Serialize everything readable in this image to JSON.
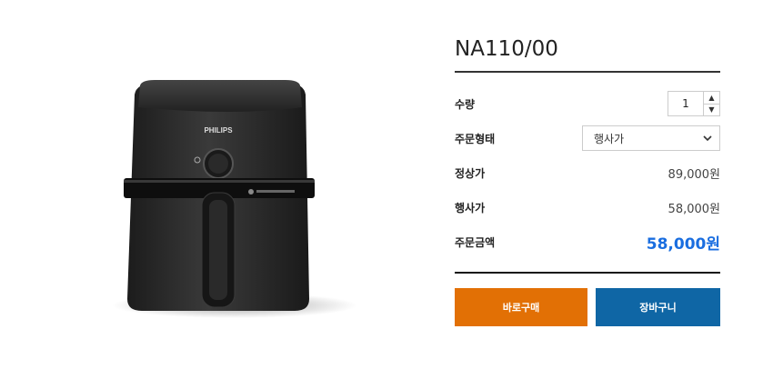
{
  "product": {
    "title": "NA110/00",
    "image_brand": "PHILIPS"
  },
  "options": {
    "quantity_label": "수량",
    "quantity_value": "1",
    "order_type_label": "주문형태",
    "order_type_selected": "행사가",
    "regular_price_label": "정상가",
    "regular_price_value": "89,000원",
    "event_price_label": "행사가",
    "event_price_value": "58,000원",
    "total_label": "주문금액",
    "total_value": "58,000원"
  },
  "actions": {
    "buy_now_label": "바로구매",
    "cart_label": "장바구니"
  },
  "colors": {
    "buy_button": "#e27005",
    "cart_button": "#0f66a5",
    "total_price": "#1a6ee0"
  }
}
